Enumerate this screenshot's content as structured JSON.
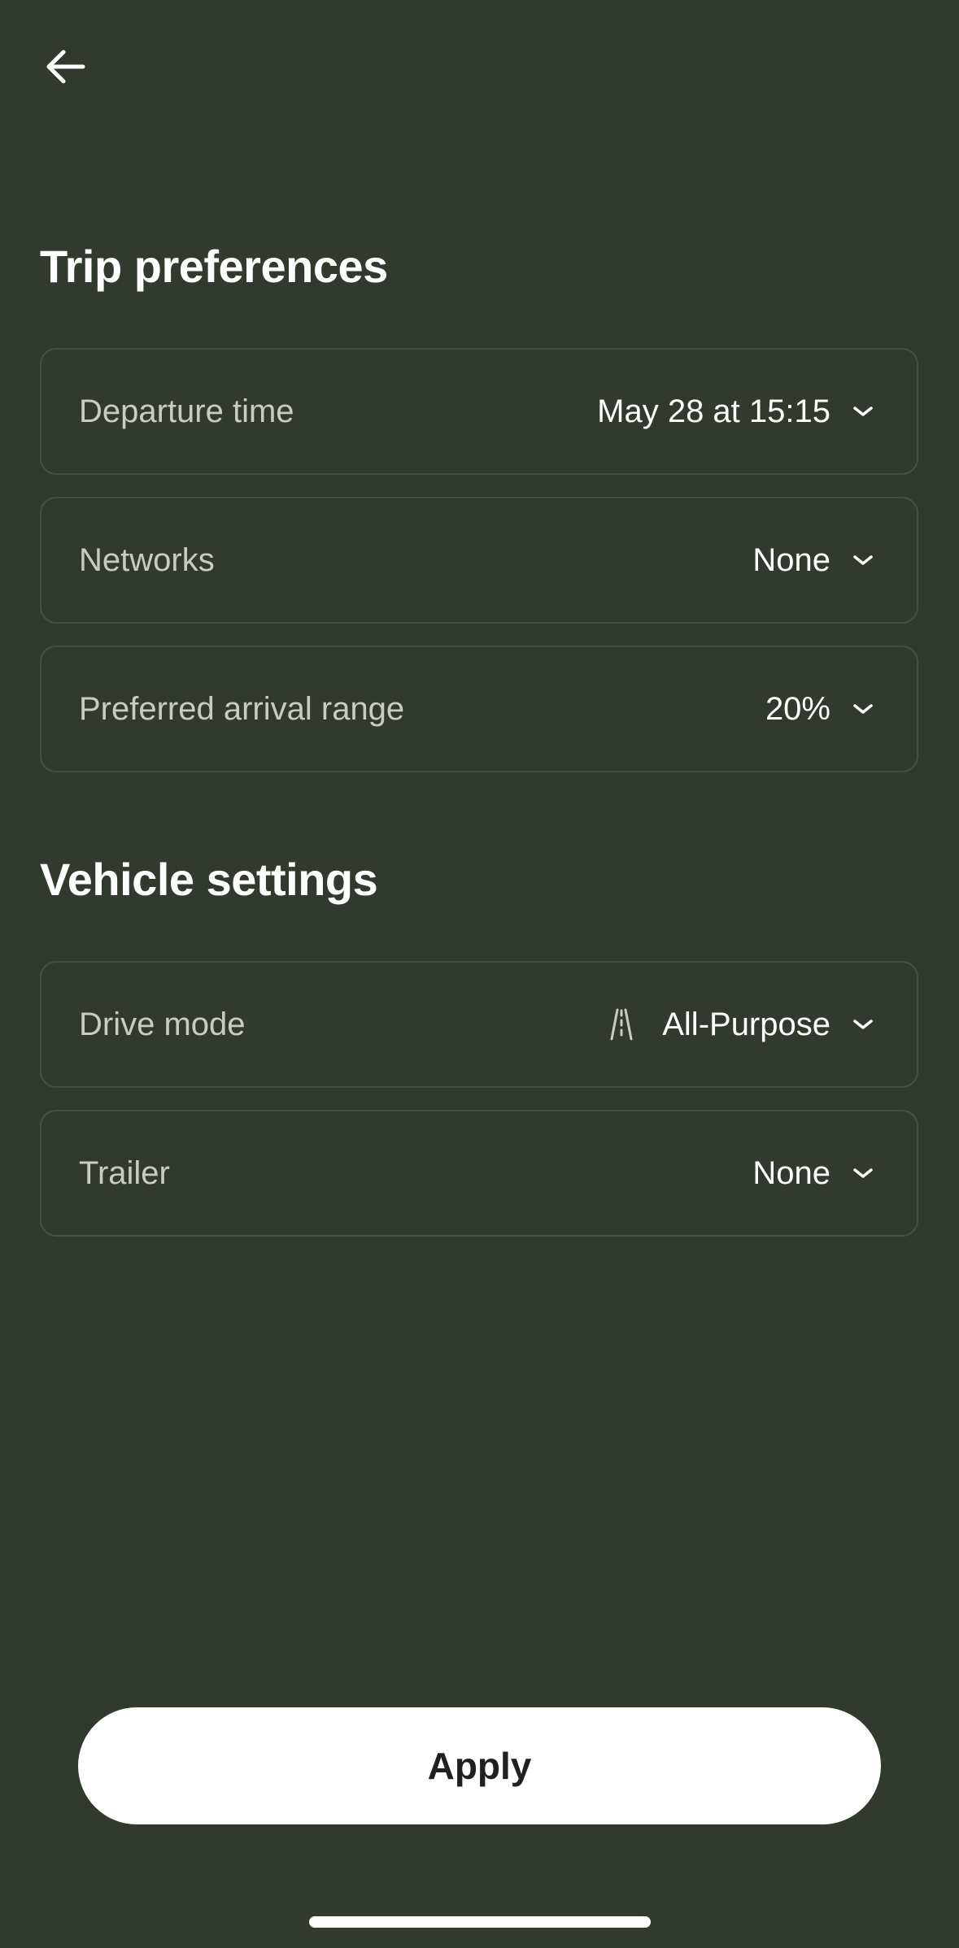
{
  "nav": {
    "back_icon": "arrow-left-icon"
  },
  "trip": {
    "title": "Trip preferences",
    "rows": [
      {
        "label": "Departure time",
        "value": "May 28 at 15:15"
      },
      {
        "label": "Networks",
        "value": "None"
      },
      {
        "label": "Preferred arrival range",
        "value": "20%"
      }
    ]
  },
  "vehicle": {
    "title": "Vehicle settings",
    "rows": [
      {
        "label": "Drive mode",
        "value": "All-Purpose",
        "icon": "road-icon"
      },
      {
        "label": "Trailer",
        "value": "None"
      }
    ]
  },
  "apply_label": "Apply",
  "colors": {
    "background": "#323a2f",
    "card_border": "#485045",
    "label": "#c9ccc6",
    "button_bg": "#ffffff",
    "button_text": "#1e211d"
  }
}
